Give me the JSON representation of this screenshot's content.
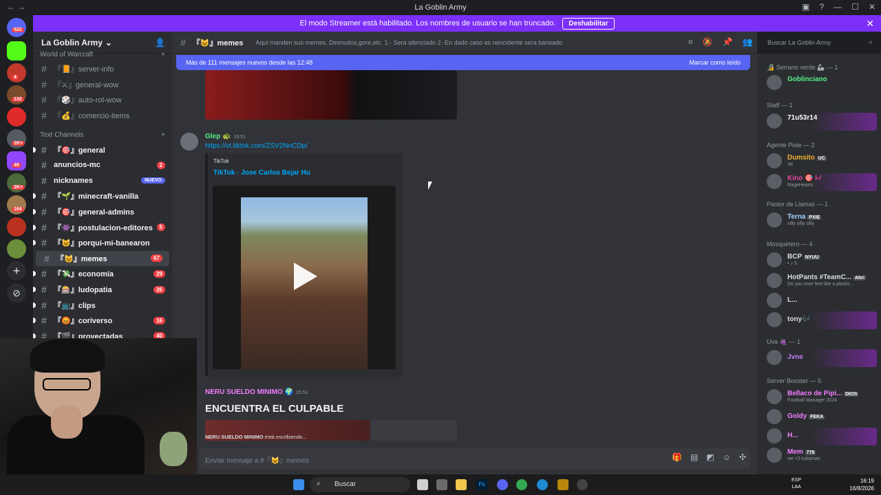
{
  "window": {
    "title": "La Goblin Army",
    "nav": "←  →"
  },
  "streamer_bar": {
    "message": "El modo Streamer está habilitado. Los nombres de usuario se han truncado.",
    "button": "Deshabilitar"
  },
  "server": {
    "name": "La Goblin Army"
  },
  "categories": {
    "top": "World of Warcraft",
    "text": "Text Channels"
  },
  "wow_channels": [
    {
      "label": "『📙』server-info"
    },
    {
      "label": "『⚔』general-wow"
    },
    {
      "label": "『🎲』auto-rol-wow"
    },
    {
      "label": "『💰』comercio-items"
    }
  ],
  "text_channels": [
    {
      "label": "『🎯』general",
      "count": ""
    },
    {
      "label": "anuncios-mc",
      "count": "2"
    },
    {
      "label": "nicknames",
      "badge": "NUEVO"
    },
    {
      "label": "『🌱』minecraft-vanilla",
      "count": ""
    },
    {
      "label": "『🎯』general-admins",
      "count": ""
    },
    {
      "label": "『👾』postulacion-editores",
      "count": "5"
    },
    {
      "label": "『😺』porqui-mi-banearon",
      "count": ""
    },
    {
      "label": "『😺』memes",
      "count": "67"
    },
    {
      "label": "『💸』economía",
      "count": "29"
    },
    {
      "label": "『🎰』ludopatia",
      "count": "26"
    },
    {
      "label": "『📺』clips",
      "count": ""
    },
    {
      "label": "『😡』coriverso",
      "count": "16"
    },
    {
      "label": "『🎬』proyectadas",
      "count": "40"
    }
  ],
  "channel_header": {
    "name": "『😺』memes",
    "topic": "Aqui manden sus memes. Desnudos,gore,etc. 1.- Sera silenciado 2.-En dado caso es reincidente sera baneado"
  },
  "search": {
    "placeholder": "Buscar La Goblin Army"
  },
  "new_messages": {
    "text": "Más de 111 mensajes nuevos desde las 12:48",
    "action": "Marcar como leído"
  },
  "messages": [
    {
      "user": "Glep 🐢",
      "time": "15:51",
      "link": "https://vt.tiktok.com/ZSV2NnCDp/",
      "embed_provider": "TikTok",
      "embed_title": "TikTok · Jose Carlos Bejar Hu"
    },
    {
      "user": "NERU SUELDO MINIMO 🌍",
      "time": "15:51",
      "text": "ENCUENTRA EL CULPABLE"
    }
  ],
  "typing": {
    "user": "NERU SUELDO MINIMO",
    "suffix": " está escribiendo..."
  },
  "composer": {
    "placeholder": "Enviar mensaje a #『😺』memes"
  },
  "member_groups": [
    {
      "header": "🔏 Serrano verde 🦾 — 1",
      "members": [
        {
          "name": "Goblinciano",
          "sub": "",
          "color": "#57f287"
        }
      ]
    },
    {
      "header": "Staff — 1",
      "members": [
        {
          "name": "71u53r14",
          "sub": "",
          "color": "#ffffff"
        }
      ]
    },
    {
      "header": "Agente Pixie — 2",
      "members": [
        {
          "name": "Dumsito",
          "tag": "UC",
          "sub": "Ve",
          "color": "#f0b232"
        },
        {
          "name": "Kino 🎯 I-/",
          "sub": "RageHearts",
          "color": "#eb459e"
        }
      ]
    },
    {
      "header": "Pastor de Llamas — 1",
      "members": [
        {
          "name": "Terna",
          "tag": "PXIE",
          "sub": "silly silly silly",
          "color": "#a6d5ff"
        }
      ]
    },
    {
      "header": "Mosquetero — 4",
      "members": [
        {
          "name": "BCP",
          "tag": "NYUU",
          "sub": "• ♪ 5",
          "color": "#dbdee1"
        },
        {
          "name": "HotPants #TeamC...",
          "tag": "Ahri",
          "sub": "Do you ever feel like a plastic...",
          "color": "#dbdee1"
        },
        {
          "name": "L...",
          "sub": "",
          "color": "#dbdee1"
        },
        {
          "name": "tony🎶",
          "sub": "",
          "color": "#dbdee1"
        }
      ]
    },
    {
      "header": "Uva 🍇 — 1",
      "members": [
        {
          "name": "Jvne",
          "sub": "",
          "color": "#c27cf5"
        }
      ]
    },
    {
      "header": "Server Booster — 5",
      "members": [
        {
          "name": "Bellaco de Pipi...",
          "tag": "DIOS",
          "sub": "Football Manager 2024",
          "color": "#f47fff"
        },
        {
          "name": "Goldy",
          "tag": "FEKA",
          "sub": "",
          "color": "#f47fff"
        },
        {
          "name": "H...",
          "sub": "",
          "color": "#f47fff"
        },
        {
          "name": "Mem",
          "tag": "778",
          "sub": "we <3 katamari",
          "color": "#f47fff"
        }
      ]
    }
  ],
  "guild_badges": [
    "522",
    "4",
    "132",
    "1K+",
    "49",
    "2K+",
    "164"
  ],
  "taskbar": {
    "search": "Buscar",
    "lang1": "ESP",
    "lang2": "LAA",
    "time": "16:19",
    "date": "16/8/2026"
  }
}
